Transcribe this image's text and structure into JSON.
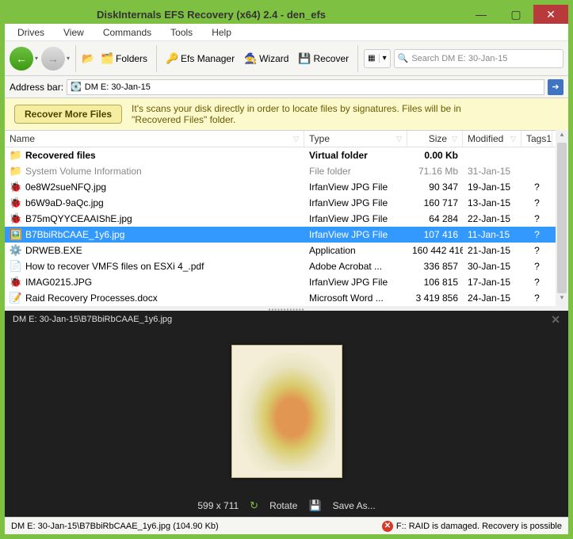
{
  "window": {
    "title": "DiskInternals EFS Recovery (x64) 2.4 - den_efs"
  },
  "menu": {
    "items": [
      "Drives",
      "View",
      "Commands",
      "Tools",
      "Help"
    ]
  },
  "toolbar": {
    "folders": "Folders",
    "efs_manager": "Efs Manager",
    "wizard": "Wizard",
    "recover": "Recover",
    "search_placeholder": "Search DM E: 30-Jan-15"
  },
  "address": {
    "label": "Address bar:",
    "value": "DM E: 30-Jan-15"
  },
  "banner": {
    "button": "Recover More Files",
    "text": "It's scans your disk directly in order to locate files by signatures. Files will be in \"Recovered Files\" folder."
  },
  "columns": [
    "Name",
    "Type",
    "Size",
    "Modified",
    "Tags1"
  ],
  "rows": [
    {
      "icon": "folder-arrow",
      "name": "Recovered files",
      "type": "Virtual folder",
      "size": "0.00 Kb",
      "mod": "",
      "tags": "",
      "bold": true
    },
    {
      "icon": "folder",
      "name": "System Volume Information",
      "type": "File folder",
      "size": "71.16 Mb",
      "mod": "31-Jan-15",
      "tags": "",
      "gray": true
    },
    {
      "icon": "bug",
      "name": "0e8W2sueNFQ.jpg",
      "type": "IrfanView JPG File",
      "size": "90 347",
      "mod": "19-Jan-15",
      "tags": "?"
    },
    {
      "icon": "bug",
      "name": "b6W9aD-9aQc.jpg",
      "type": "IrfanView JPG File",
      "size": "160 717",
      "mod": "13-Jan-15",
      "tags": "?"
    },
    {
      "icon": "bug",
      "name": "B75mQYYCEAAIShE.jpg",
      "type": "IrfanView JPG File",
      "size": "64 284",
      "mod": "22-Jan-15",
      "tags": "?"
    },
    {
      "icon": "img",
      "name": "B7BbiRbCAAE_1y6.jpg",
      "type": "IrfanView JPG File",
      "size": "107 416",
      "mod": "11-Jan-15",
      "tags": "?",
      "selected": true
    },
    {
      "icon": "exe",
      "name": "DRWEB.EXE",
      "type": "Application",
      "size": "160 442 416",
      "mod": "21-Jan-15",
      "tags": "?"
    },
    {
      "icon": "pdf",
      "name": "How to recover VMFS files on ESXi 4_.pdf",
      "type": "Adobe Acrobat ...",
      "size": "336 857",
      "mod": "30-Jan-15",
      "tags": "?"
    },
    {
      "icon": "bug",
      "name": "IMAG0215.JPG",
      "type": "IrfanView JPG File",
      "size": "106 815",
      "mod": "17-Jan-15",
      "tags": "?"
    },
    {
      "icon": "doc",
      "name": "Raid Recovery Processes.docx",
      "type": "Microsoft Word ...",
      "size": "3 419 856",
      "mod": "24-Jan-15",
      "tags": "?"
    }
  ],
  "preview": {
    "path": "DM E: 30-Jan-15\\B7BbiRbCAAE_1y6.jpg",
    "dimensions": "599 x 711",
    "rotate": "Rotate",
    "save_as": "Save As..."
  },
  "status": {
    "left": "DM E: 30-Jan-15\\B7BbiRbCAAE_1y6.jpg (104.90 Kb)",
    "right": "F:: RAID is damaged. Recovery is possible"
  }
}
